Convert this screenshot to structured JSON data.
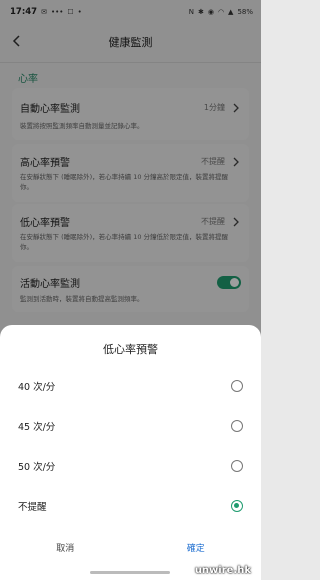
{
  "status_bar": {
    "time": "17:47",
    "battery": "58%",
    "icons": [
      "message-icon",
      "dots-icon",
      "mail-icon",
      "dot-icon",
      "nfc-icon",
      "bluetooth-icon",
      "location-icon",
      "wifi-icon",
      "signal-icon"
    ]
  },
  "header": {
    "title": "健康監測"
  },
  "section": {
    "title": "心率"
  },
  "settings": {
    "auto": {
      "label": "自動心率監測",
      "value": "1分鐘",
      "desc": "裝置將按照監測頻率自動測量並記錄心率。"
    },
    "high": {
      "label": "高心率預警",
      "value": "不提醒",
      "desc": "在安靜狀態下 (睡眠除外)，若心率持續 10 分鐘高於限定值，裝置將提醒你。"
    },
    "low": {
      "label": "低心率預警",
      "value": "不提醒",
      "desc": "在安靜狀態下 (睡眠除外)，若心率持續 10 分鐘低於限定值，裝置將提醒你。"
    },
    "activity": {
      "label": "活動心率監測",
      "desc": "監測到活動時，裝置將自動提高監測頻率。",
      "enabled": true
    }
  },
  "sheet": {
    "title": "低心率預警",
    "options": [
      {
        "label": "40 次/分",
        "selected": false
      },
      {
        "label": "45 次/分",
        "selected": false
      },
      {
        "label": "50 次/分",
        "selected": false
      },
      {
        "label": "不提醒",
        "selected": true
      }
    ],
    "cancel_label": "取消",
    "ok_label": "確定"
  },
  "colors": {
    "accent": "#1f9b6f",
    "link": "#1f6fd0"
  },
  "watermark": "unwire.hk"
}
